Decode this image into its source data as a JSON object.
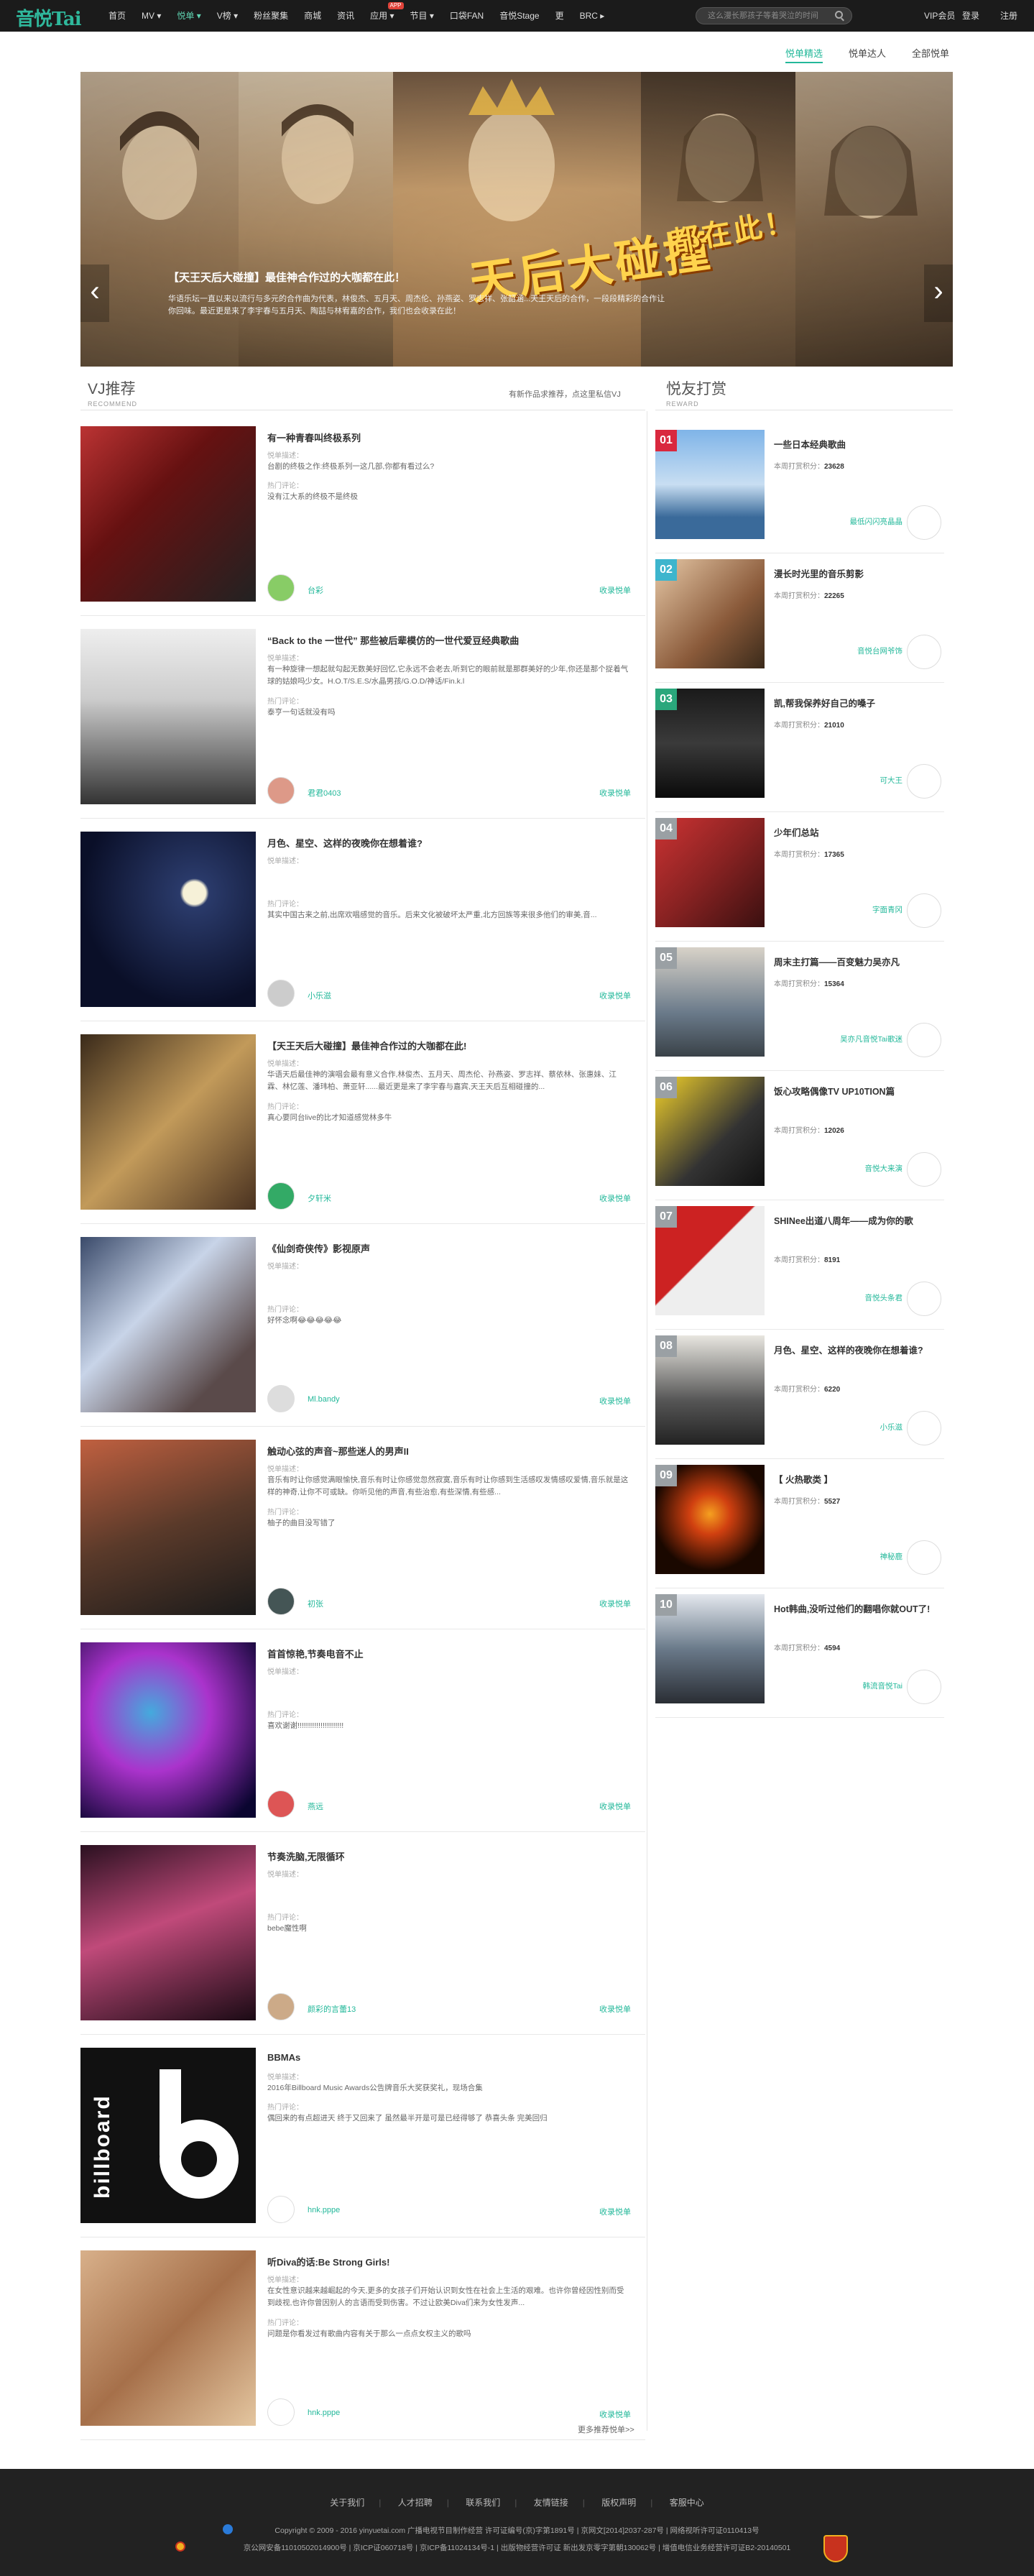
{
  "header": {
    "logo": "音悦Tai",
    "nav": [
      {
        "label": "首页"
      },
      {
        "label": "MV ▾"
      },
      {
        "label": "悦单 ▾"
      },
      {
        "label": "V榜 ▾"
      },
      {
        "label": "粉丝聚集"
      },
      {
        "label": "商城"
      },
      {
        "label": "资讯"
      },
      {
        "label": "应用 ▾",
        "badge": "APP"
      },
      {
        "label": "节目 ▾"
      },
      {
        "label": "口袋FAN"
      },
      {
        "label": "音悦Stage"
      },
      {
        "label": "更"
      },
      {
        "label": "BRC ▸"
      }
    ],
    "search_placeholder": "这么漫长那孩子等着哭泣的时间",
    "vip": "VIP会员",
    "login": "登录",
    "register": "注册"
  },
  "subtabs": [
    "悦单精选",
    "悦单达人",
    "全部悦单"
  ],
  "banner": {
    "title": "【天王天后大碰撞】最佳神合作过的大咖都在此！",
    "desc": "华语乐坛一直以来以流行与多元的合作曲为代表，林俊杰、五月天、周杰伦、孙燕姿、罗志祥、张韶涵...天王天后的合作，一段段精彩的合作让你回味。最近更是来了李宇春与五月天、陶喆与林宥嘉的合作，我们也会收录在此！",
    "overlay": "天后大碰撞",
    "overlay2": "都在此！"
  },
  "vj_section": {
    "title": "VJ推荐",
    "subtitle": "RECOMMEND",
    "right": "有新作品求推荐，点这里私信VJ"
  },
  "reward_section": {
    "title": "悦友打赏",
    "subtitle": "REWARD"
  },
  "labels": {
    "desc": "悦单描述：",
    "hot": "热门评论：",
    "fav": "收录悦单"
  },
  "cards": [
    {
      "title": "有一种青春叫终极系列",
      "desc": "台剧的终极之作:终极系列一这几部,你都有看过么?",
      "comment": "没有江大系的终极不是终极",
      "user": "台彩"
    },
    {
      "title": "“Back to the 一世代” 那些被后辈模仿的一世代爱豆经典歌曲",
      "desc": "有一种旋律一想起就勾起无数美好回忆,它永远不会老去,听到它的眼前就是那群美好的少年,你还是那个捉着气球的姑娘吗少女。H.O.T/S.E.S/水晶男孩/G.O.D/神话/Fin.k.l",
      "comment": "泰亨一句话就没有吗",
      "user": "君君0403"
    },
    {
      "title": "月色、星空、这样的夜晚你在想着谁?",
      "desc": "",
      "comment": "其实中国古来之前,出席欢唱感觉的音乐。后来文化被破坏太严重,北方回族等来很多他们的审美,音...",
      "user": "小乐滋"
    },
    {
      "title": "【天王天后大碰撞】最佳神合作过的大咖都在此!",
      "desc": "华语天后最佳神的演唱会最有意义合作,林俊杰、五月天、周杰伦、孙燕姿、罗志祥、蔡依林、张惠妹、江霖、林忆莲、潘玮柏、萧亚轩......最近更是来了李宇春与嘉宾,天王天后互相碰撞的...",
      "comment": "真心要同台live的比才知道感觉林多牛",
      "user": "夕轩米"
    },
    {
      "title": "《仙剑奇侠传》影视原声",
      "desc": "",
      "comment": "好怀念啊😂😂😂😂😂",
      "user": "Ml.bandy"
    },
    {
      "title": "触动心弦的声音~那些迷人的男声II",
      "desc": "音乐有时让你感觉满眼愉快,音乐有时让你感觉忽然寂寞,音乐有时让你感到生活感叹发情感叹爱情,音乐就是这样的神奇,让你不可或缺。你听见他的声音,有些治愈,有些深情,有些感...",
      "comment": "柚子的曲目没写错了",
      "user": "初张"
    },
    {
      "title": "首首惊艳,节奏电音不止",
      "desc": "",
      "comment": "喜欢谢谢!!!!!!!!!!!!!!!!!!!!!!",
      "user": "燕远"
    },
    {
      "title": "节奏洗脑,无限循环",
      "desc": "",
      "comment": "bebe魔性啊",
      "user": "颜彩的言蕾13"
    },
    {
      "title": "BBMAs",
      "desc": "2016年Billboard Music Awards公告牌音乐大奖获奖礼，现场合集",
      "comment": "偶回来的有点超进天 终于又回来了 虽然最半开是可是已经得够了 恭喜头条 完美回归",
      "user": "hnk.pppe"
    },
    {
      "title": "听Diva的话:Be Strong Girls!",
      "desc": "在女性意识越来越崛起的今天,更多的女孩子们开始认识到女性在社会上生活的艰难。也许你曾经因性别而受到歧视,也许你曾因别人的言语而受到伤害。不过让欧美Diva们来为女性发声...",
      "comment": "问题是你看发过有歌曲内容有关于那么一点点女权主义的歌吗",
      "user": "hnk.pppe"
    }
  ],
  "more": "更多推荐悦单>>",
  "ranking": [
    {
      "num": "01",
      "title": "一些日本经典歌曲",
      "score": "23628",
      "user": "最低闪闪亮晶晶"
    },
    {
      "num": "02",
      "title": "漫长时光里的音乐剪影",
      "score": "22265",
      "user": "音悦台网爷饰"
    },
    {
      "num": "03",
      "title": "凯,帮我保养好自己的嗓子",
      "score": "21010",
      "user": "可大王"
    },
    {
      "num": "04",
      "title": "少年们总站",
      "score": "17365",
      "user": "字面青冈"
    },
    {
      "num": "05",
      "title": "周末主打篇——百变魅力吴亦凡",
      "score": "15364",
      "user": "吴亦凡音悦Tai歌迷"
    },
    {
      "num": "06",
      "title": "饭心攻略偶像TV UP10TION篇",
      "score": "12026",
      "user": "音悦大来演"
    },
    {
      "num": "07",
      "title": "SHINee出道八周年——成为你的歌",
      "score": "8191",
      "user": "音悦头条君"
    },
    {
      "num": "08",
      "title": "月色、星空、这样的夜晚你在想着谁?",
      "score": "6220",
      "user": "小乐滋"
    },
    {
      "num": "09",
      "title": "【 火热歌类 】",
      "score": "5527",
      "user": "神秘鹿"
    },
    {
      "num": "10",
      "title": "Hot韩曲,没听过他们的翻唱你就OUT了!",
      "score": "4594",
      "user": "韩流音悦Tai"
    }
  ],
  "ranking_label": "本周打赏积分：",
  "colors": {
    "accent": "#23b89a",
    "rank1": "#d9283e",
    "rank2": "#3db5cd",
    "rank3": "#2aa77c",
    "rank_other": "#9aa0a4",
    "footer_bg": "#222222"
  },
  "footer": {
    "links": [
      "关于我们",
      "人才招聘",
      "联系我们",
      "友情链接",
      "版权声明",
      "客服中心"
    ],
    "line1": "Copyright © 2009 - 2016 yinyuetai.com 广播电视节目制作经营 许可证编号(京)字第1891号 | 京网文[2014]2037-287号 | 网络视听许可证0110413号",
    "line2": "京公网安备11010502014900号 | 京ICP证060718号 | 京ICP备11024134号-1 | 出版物经营许可证 新出发京零字第朝130062号 | 增值电信业务经营许可证B2-20140501"
  }
}
